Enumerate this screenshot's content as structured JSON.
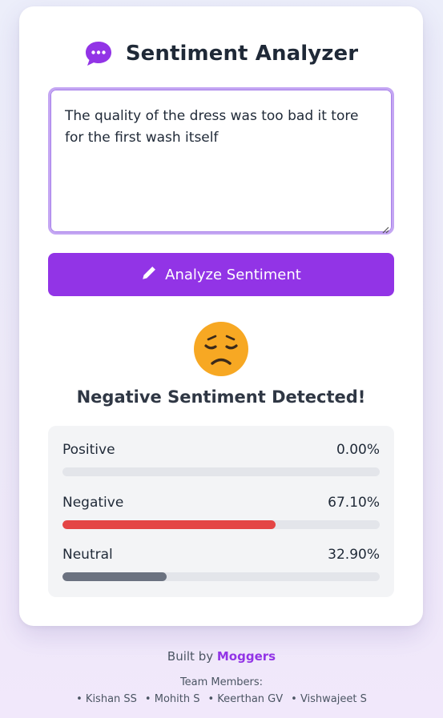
{
  "app": {
    "title": "Sentiment Analyzer",
    "icon": "speech-bubble-dots-icon",
    "accent_color": "#9234e6"
  },
  "input": {
    "value": "The quality of the dress was too bad it tore for the first wash itself"
  },
  "analyze_button": {
    "label": "Analyze Sentiment",
    "icon": "pencil-icon"
  },
  "result": {
    "emoji": "pensive-face-icon",
    "heading": "Negative Sentiment Detected!"
  },
  "scores": [
    {
      "label": "Positive",
      "value": "0.00%",
      "fraction": 0.0,
      "color": "#22c55e"
    },
    {
      "label": "Negative",
      "value": "67.10%",
      "fraction": 0.671,
      "color": "#e44545"
    },
    {
      "label": "Neutral",
      "value": "32.90%",
      "fraction": 0.329,
      "color": "#6b7280"
    }
  ],
  "footer": {
    "built_by_prefix": "Built by",
    "brand": "Moggers",
    "team_label": "Team Members:",
    "members": [
      "• Kishan SS",
      "• Mohith S",
      "• Keerthan GV",
      "• Vishwajeet S"
    ]
  }
}
